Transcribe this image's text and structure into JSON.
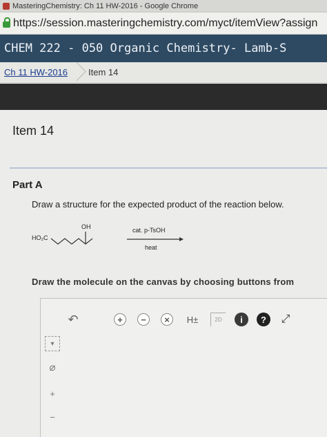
{
  "browser": {
    "window_title": "MasteringChemistry: Ch 11 HW-2016 - Google Chrome",
    "url": "https://session.masteringchemistry.com/myct/itemView?assign"
  },
  "course": {
    "title": "CHEM 222 - 050 Organic Chemistry- Lamb-S"
  },
  "breadcrumb": {
    "assignment": "Ch 11 HW-2016",
    "current": "Item 14"
  },
  "item": {
    "title": "Item 14",
    "part_title": "Part A",
    "prompt": "Draw a structure for the expected product of the reaction below.",
    "reaction": {
      "reactant_left": "HO₂C",
      "reactant_oh": "OH",
      "reagent": "cat. p-TsOH",
      "condition": "heat"
    },
    "instruction": "Draw the molecule on the canvas by choosing buttons from"
  },
  "editor": {
    "toolbar": {
      "undo": "↶",
      "zoom_in": "+",
      "zoom_out": "−",
      "clear": "×",
      "hydrogen_toggle": "H±",
      "dimension_label": "2D",
      "info": "i",
      "help": "?",
      "expand": "⤢"
    },
    "side_tools": {
      "eraser": "⌀",
      "charge_plus": "+",
      "charge_minus": "−"
    },
    "colors": {
      "info_button": "#3a3a3a",
      "help_button": "#222222"
    }
  }
}
